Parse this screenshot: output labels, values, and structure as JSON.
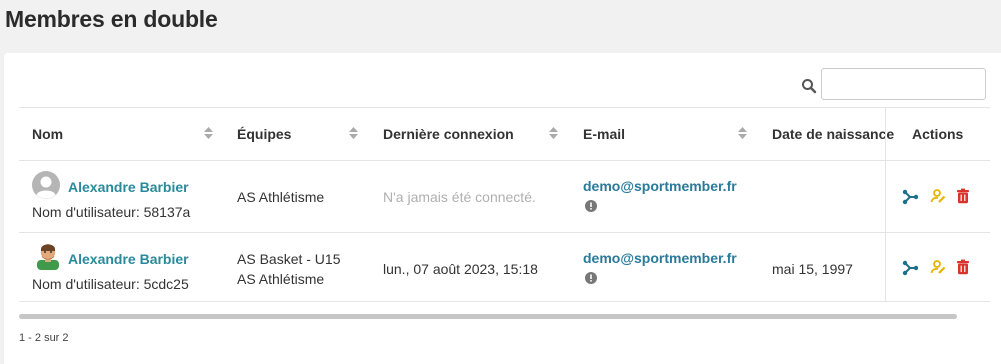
{
  "page": {
    "title": "Membres en double"
  },
  "search": {
    "placeholder": "",
    "value": ""
  },
  "table": {
    "columns": [
      {
        "label": "Nom",
        "sortable": true
      },
      {
        "label": "Équipes",
        "sortable": true
      },
      {
        "label": "Dernière connexion",
        "sortable": true
      },
      {
        "label": "E-mail",
        "sortable": true
      },
      {
        "label": "Date de naissance",
        "sortable": false
      },
      {
        "label": "Actions",
        "sortable": false
      }
    ],
    "rows": [
      {
        "avatar": "default-avatar-icon",
        "name": "Alexandre Barbier",
        "username": "Nom d'utilisateur: 58137a",
        "teams": [
          "AS Athlétisme"
        ],
        "last_login": "N'a jamais été connecté.",
        "email": "demo@sportmember.fr",
        "birthdate": ""
      },
      {
        "avatar": "person-avatar-icon",
        "name": "Alexandre Barbier",
        "username": "Nom d'utilisateur: 5cdc25",
        "teams": [
          "AS Basket - U15",
          "AS Athlétisme"
        ],
        "last_login": "lun., 07 août 2023, 15:18",
        "email": "demo@sportmember.fr",
        "birthdate": "mai 15, 1997"
      }
    ]
  },
  "pagination": {
    "text": "1 - 2 sur 2"
  },
  "colors": {
    "link": "#2a8a9b",
    "merge_icon": "#1f6f8b",
    "edit_icon": "#e8b400",
    "delete_icon": "#d9342b"
  }
}
